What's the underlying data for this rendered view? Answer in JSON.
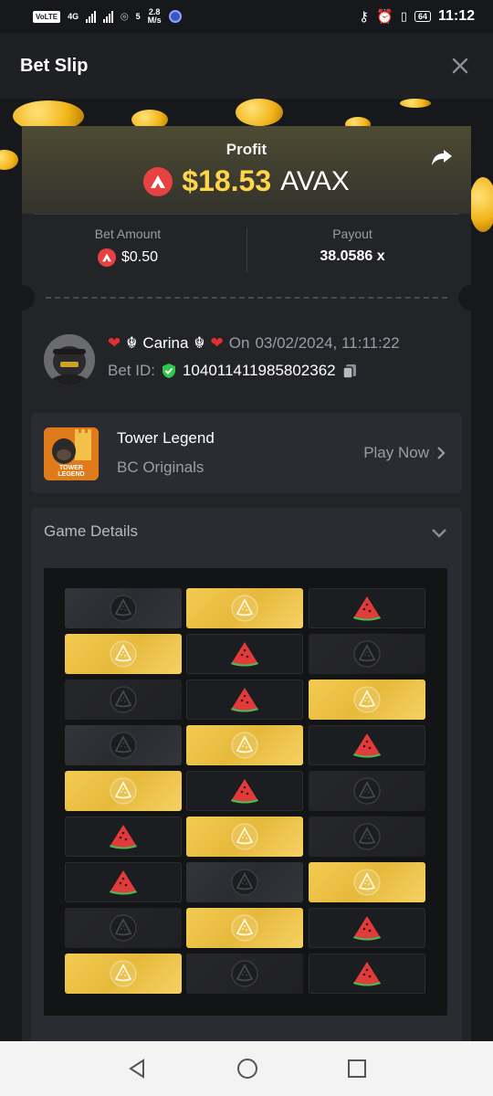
{
  "status_bar": {
    "volte": "VoLTE",
    "net1": "4G",
    "net2": "5",
    "speed_value": "2.8",
    "speed_unit": "M/s",
    "battery": "64",
    "time": "11:12"
  },
  "header": {
    "title": "Bet Slip",
    "close_icon": "close-icon"
  },
  "profit": {
    "label": "Profit",
    "amount": "$18.53",
    "currency": "AVAX"
  },
  "bet": {
    "amount_label": "Bet Amount",
    "amount_value": "$0.50",
    "payout_label": "Payout",
    "payout_value": "38.0586 x"
  },
  "user": {
    "name": "Carina",
    "date_prefix": "On",
    "date": "03/02/2024, 11:11:22",
    "bet_id_label": "Bet ID:",
    "bet_id": "104011411985802362"
  },
  "game": {
    "name": "Tower Legend",
    "provider": "BC Originals",
    "thumb_text": "TOWER LEGEND",
    "play_label": "Play Now"
  },
  "details": {
    "title": "Game Details"
  },
  "board": {
    "columns": 3,
    "rows": [
      [
        "dim",
        "gold",
        "melon"
      ],
      [
        "gold",
        "melon",
        "dim2"
      ],
      [
        "dim2",
        "melon",
        "gold"
      ],
      [
        "dim",
        "gold",
        "melon"
      ],
      [
        "gold",
        "melon",
        "dim2"
      ],
      [
        "melon",
        "gold",
        "dim2"
      ],
      [
        "melon",
        "dim",
        "gold"
      ],
      [
        "dim2",
        "gold",
        "melon"
      ],
      [
        "gold",
        "dim2",
        "melon"
      ]
    ]
  },
  "colors": {
    "accent_gold": "#ffd54a",
    "avax_red": "#e84142",
    "tile_gold": "#f3cb52"
  }
}
